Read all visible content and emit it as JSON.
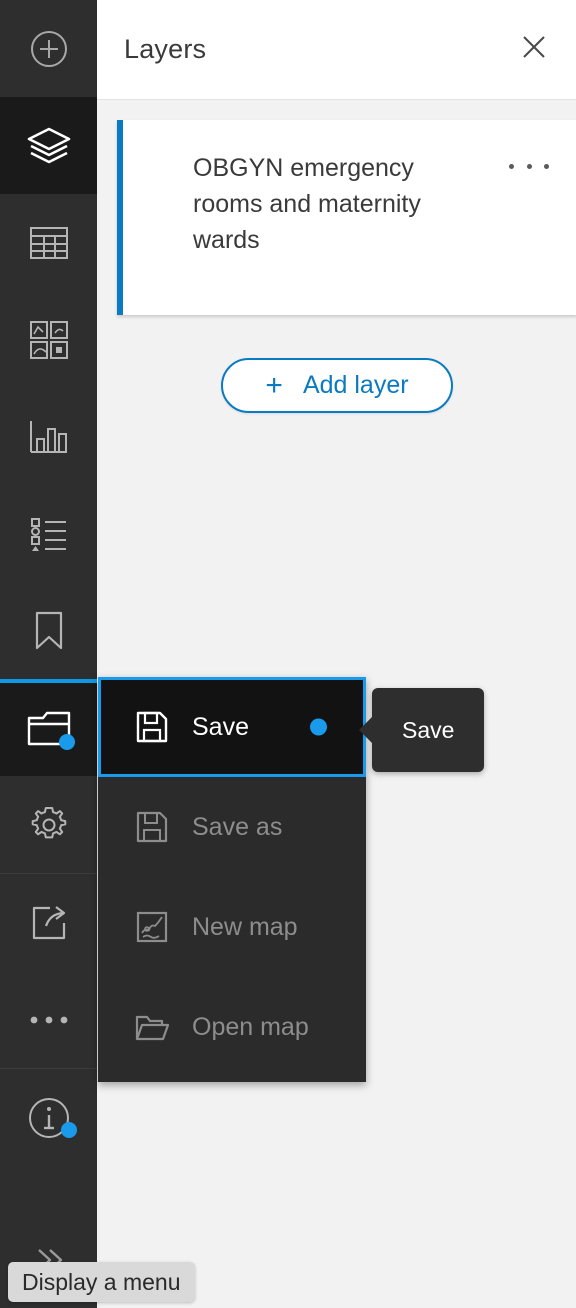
{
  "sidebar": {
    "items": [
      {
        "name": "add",
        "icon": "circle-plus-icon",
        "active": false,
        "badge": false
      },
      {
        "name": "layers",
        "icon": "layers-icon",
        "active": true,
        "badge": false
      },
      {
        "name": "table",
        "icon": "table-icon",
        "active": false,
        "badge": false
      },
      {
        "name": "widgets",
        "icon": "widgets-grid-icon",
        "active": false,
        "badge": false
      },
      {
        "name": "charts",
        "icon": "bar-chart-icon",
        "active": false,
        "badge": false
      },
      {
        "name": "legend",
        "icon": "legend-list-icon",
        "active": false,
        "badge": false
      },
      {
        "name": "bookmarks",
        "icon": "bookmark-icon",
        "active": false,
        "badge": false
      },
      {
        "name": "map-files",
        "icon": "folder-icon",
        "active": true,
        "badge": true
      },
      {
        "name": "settings",
        "icon": "gear-icon",
        "active": false,
        "badge": false
      },
      {
        "name": "share",
        "icon": "share-icon",
        "active": false,
        "badge": false
      },
      {
        "name": "more",
        "icon": "ellipsis-icon",
        "active": false,
        "badge": false
      },
      {
        "name": "info",
        "icon": "info-circle-icon",
        "active": false,
        "badge": true
      },
      {
        "name": "expand",
        "icon": "chevron-double-right-icon",
        "active": false,
        "badge": false
      }
    ]
  },
  "panel": {
    "title": "Layers",
    "close_icon": "close-icon",
    "layer_card": {
      "title": "OBGYN emergency rooms and maternity wards",
      "menu_icon": "ellipsis-icon",
      "accent_color": "#0a7ac2"
    },
    "add_layer": {
      "plus": "+",
      "label": "Add layer"
    }
  },
  "menu": {
    "items": [
      {
        "label": "Save",
        "icon": "floppy-disk-icon",
        "highlighted": true,
        "dot": true
      },
      {
        "label": "Save as",
        "icon": "floppy-disk-icon",
        "highlighted": false,
        "dot": false
      },
      {
        "label": "New map",
        "icon": "new-map-icon",
        "highlighted": false,
        "dot": false
      },
      {
        "label": "Open map",
        "icon": "open-folder-icon",
        "highlighted": false,
        "dot": false
      }
    ]
  },
  "tooltips": {
    "save": "Save",
    "display_menu": "Display a menu"
  },
  "colors": {
    "accent_blue": "#1a9aea",
    "link_blue": "#0a7ac2",
    "sidebar_bg": "#2e2e2e",
    "sidebar_active_bg": "#1a1a1a",
    "menu_bg": "#2b2b2b",
    "panel_bg": "#f2f2f2"
  }
}
